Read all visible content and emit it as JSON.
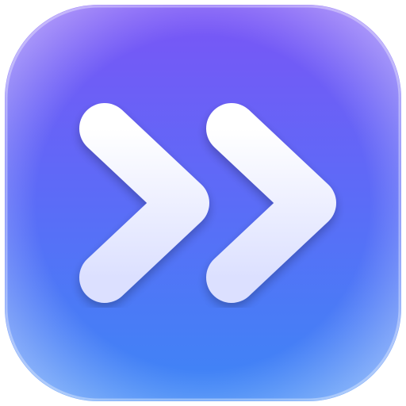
{
  "icon": {
    "name": "double-chevron-right-icon",
    "colors": {
      "background_top": "#7A55F6",
      "background_mid": "#5B6CF7",
      "background_bottom": "#3D86F6",
      "chevron_fill_top": "#FFFFFF",
      "chevron_fill_bottom": "#DCE0FF"
    }
  }
}
